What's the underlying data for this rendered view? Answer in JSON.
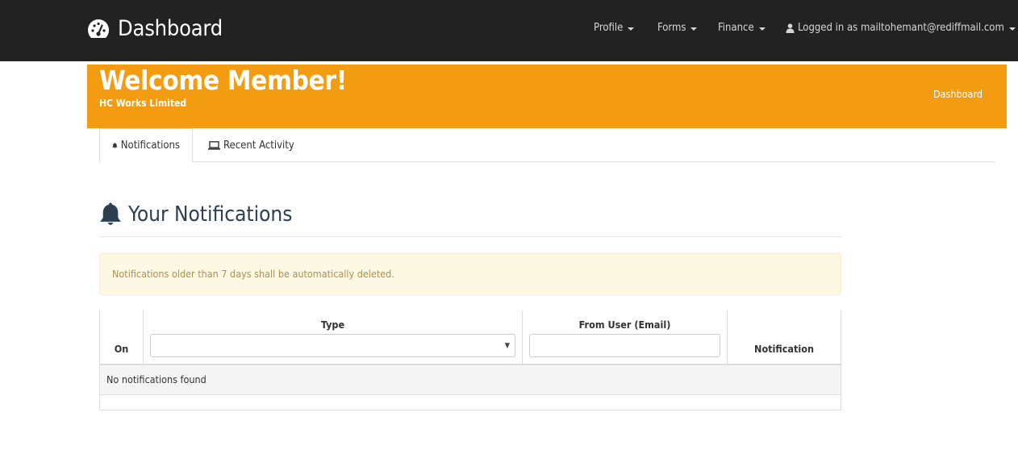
{
  "navbar": {
    "brand": "Dashboard",
    "brand_icon": "dashboard-gauge-icon",
    "items": [
      {
        "label": "Profile"
      },
      {
        "label": "Forms"
      },
      {
        "label": "Finance"
      }
    ],
    "user_label": "Logged in as mailtohemant@rediffmail.com",
    "user_icon": "user-icon"
  },
  "hero": {
    "title": "Welcome Member!",
    "subtitle": "HC Works Limited",
    "breadcrumb": "Dashboard",
    "color": "#f39c12"
  },
  "tabs": [
    {
      "label": "Notifications",
      "icon": "bell-icon",
      "active": true
    },
    {
      "label": "Recent Activity",
      "icon": "laptop-icon",
      "active": false
    }
  ],
  "section": {
    "title": "Your Notifications",
    "icon": "bell-icon"
  },
  "alert": {
    "text": "Notifications older than 7 days shall be automatically deleted."
  },
  "table": {
    "columns": {
      "on": "On",
      "type": "Type",
      "from_user": "From User (Email)",
      "notification": "Notification"
    },
    "type_select_value": "",
    "from_user_value": "",
    "empty_message": "No notifications found"
  },
  "colors": {
    "navbar_bg": "#222222",
    "accent": "#f39c12",
    "heading": "#2c3e50",
    "alert_bg": "#fcf8e3"
  }
}
